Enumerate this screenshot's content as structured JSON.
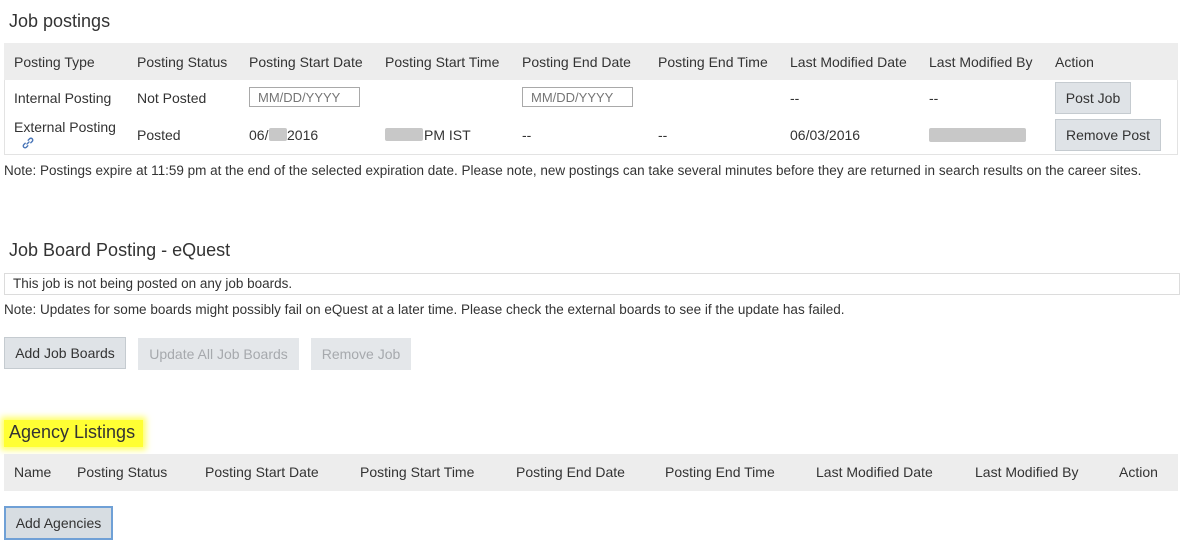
{
  "job_postings": {
    "title": "Job postings",
    "columns": [
      "Posting Type",
      "Posting Status",
      "Posting Start Date",
      "Posting Start Time",
      "Posting End Date",
      "Posting End Time",
      "Last Modified Date",
      "Last Modified By",
      "Action"
    ],
    "rows": [
      {
        "type": "Internal Posting",
        "status": "Not Posted",
        "start_date_placeholder": "MM/DD/YYYY",
        "end_date_placeholder": "MM/DD/YYYY",
        "last_modified_date": "--",
        "last_modified_by": "--",
        "action_label": "Post Job"
      },
      {
        "type": "External Posting",
        "link_icon": "link-icon",
        "status": "Posted",
        "start_date_prefix": "06/",
        "start_date_suffix": "2016",
        "start_time_suffix": "PM IST",
        "end_date": "--",
        "end_time": "--",
        "last_modified_date": "06/03/2016",
        "action_label": "Remove Post"
      }
    ],
    "note": "Note: Postings expire at 11:59 pm at the end of the selected expiration date. Please note, new postings can take several minutes before they are returned in search results on the career sites."
  },
  "job_board": {
    "title": "Job Board Posting - eQuest",
    "status_text": "This job is not being posted on any job boards.",
    "note": "Note: Updates for some boards might possibly fail on eQuest at a later time. Please check the external boards to see if the update has failed.",
    "buttons": {
      "add": "Add Job Boards",
      "update_all": "Update All Job Boards",
      "remove": "Remove Job"
    }
  },
  "agency": {
    "title": "Agency Listings",
    "highlight_color": "#ffff33",
    "columns": [
      "Name",
      "Posting Status",
      "Posting Start Date",
      "Posting Start Time",
      "Posting End Date",
      "Posting End Time",
      "Last Modified Date",
      "Last Modified By",
      "Action"
    ],
    "add_button": "Add Agencies"
  }
}
